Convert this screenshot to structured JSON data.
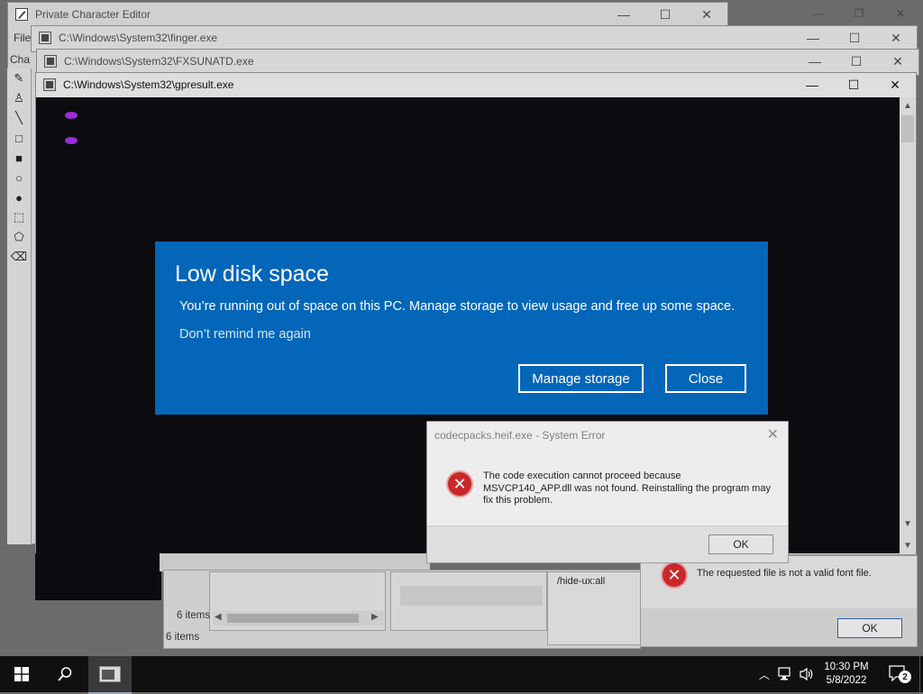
{
  "windows": {
    "char_editor": {
      "title": "Private Character Editor",
      "menu_file": "File",
      "menu_char": "Cha"
    },
    "finger": {
      "title": "C:\\Windows\\System32\\finger.exe"
    },
    "fxsunatd": {
      "title": "C:\\Windows\\System32\\FXSUNATD.exe"
    },
    "gpresult": {
      "title": "C:\\Windows\\System32\\gpresult.exe"
    },
    "explorer": {
      "status_items_1": "6 items",
      "status_items_2": "6 items",
      "cmd_text": "/hide-ux:all"
    },
    "font_error": {
      "message": "The requested file is not a valid font file.",
      "ok_label": "OK"
    }
  },
  "toast": {
    "title": "Low disk space",
    "body": "You’re running out of space on this PC. Manage storage to view usage and free up some space.",
    "link": "Don’t remind me again",
    "primary_button": "Manage storage",
    "secondary_button": "Close"
  },
  "error_dialog": {
    "title": "codecpacks.heif.exe - System Error",
    "message": "The code execution cannot proceed because MSVCP140_APP.dll was not found. Reinstalling the program may fix this problem.",
    "ok_label": "OK"
  },
  "taskbar": {
    "time": "10:30 PM",
    "date": "5/8/2022",
    "notification_count": "2"
  },
  "icons": [
    "windows-start-icon",
    "search-icon",
    "console-app-icon",
    "chevron-up-icon",
    "network-icon",
    "volume-icon",
    "notification-icon",
    "error-icon",
    "pencil-icon",
    "brush-icon",
    "line-icon",
    "rectangle-icon",
    "filled-rectangle-icon",
    "ellipse-icon",
    "filled-ellipse-icon",
    "rect-select-icon",
    "freeform-select-icon",
    "eraser-icon"
  ],
  "colors": {
    "toast_bg": "#0366b9",
    "console_bg": "#0c0b0f",
    "taskbar_bg": "#101010",
    "error_red": "#c8282a"
  }
}
